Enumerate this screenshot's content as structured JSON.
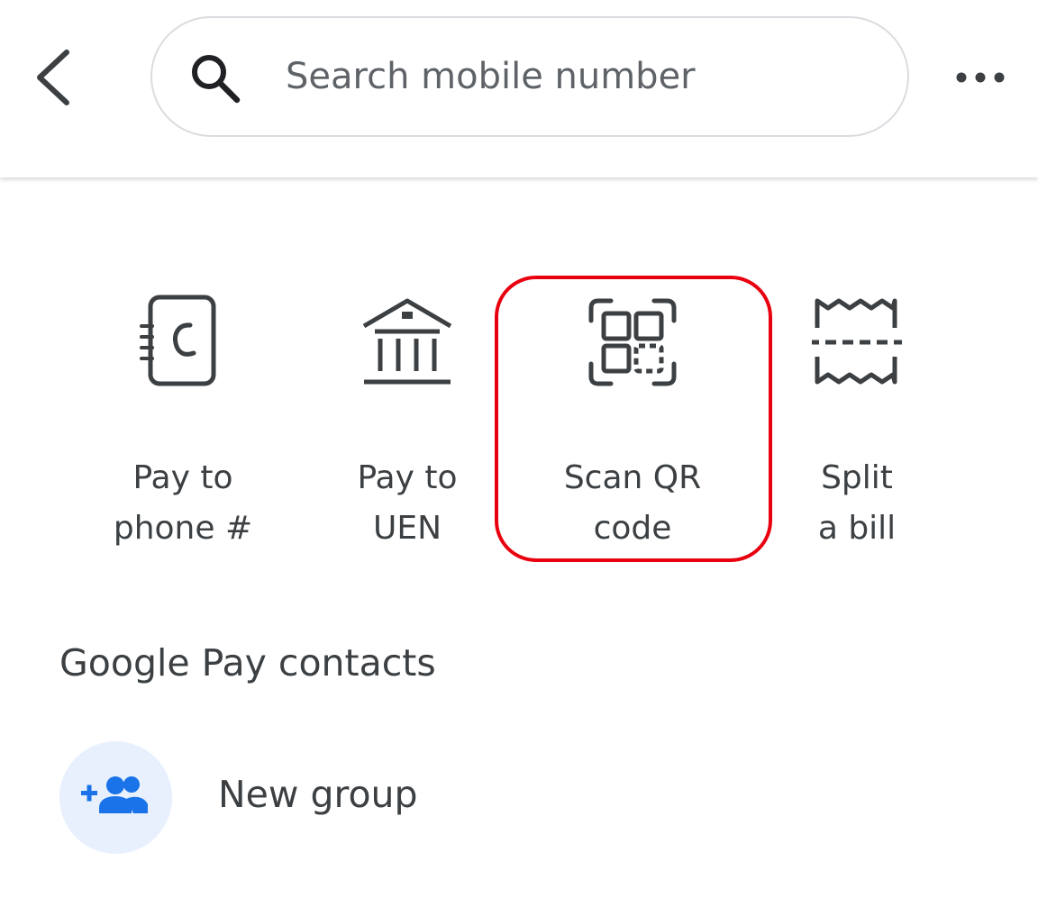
{
  "header": {
    "back_icon": "chevron-left-icon",
    "search_placeholder": "Search mobile number",
    "search_value": "",
    "search_icon": "search-icon",
    "more_icon": "more-horiz-icon"
  },
  "actions": [
    {
      "icon": "contact-book-icon",
      "label_line1": "Pay to",
      "label_line2": "phone #"
    },
    {
      "icon": "bank-icon",
      "label_line1": "Pay to",
      "label_line2": "UEN"
    },
    {
      "icon": "qr-scan-icon",
      "label_line1": "Scan QR",
      "label_line2": "code",
      "highlighted": true
    },
    {
      "icon": "receipt-icon",
      "label_line1": "Split",
      "label_line2": "a bill"
    }
  ],
  "contacts": {
    "title": "Google Pay contacts",
    "new_group_label": "New group",
    "new_group_icon": "group-add-icon"
  },
  "colors": {
    "highlight": "#e8000f",
    "accent": "#1a73e8",
    "avatar_bg": "#e8f0fe",
    "text": "#3c4043"
  }
}
